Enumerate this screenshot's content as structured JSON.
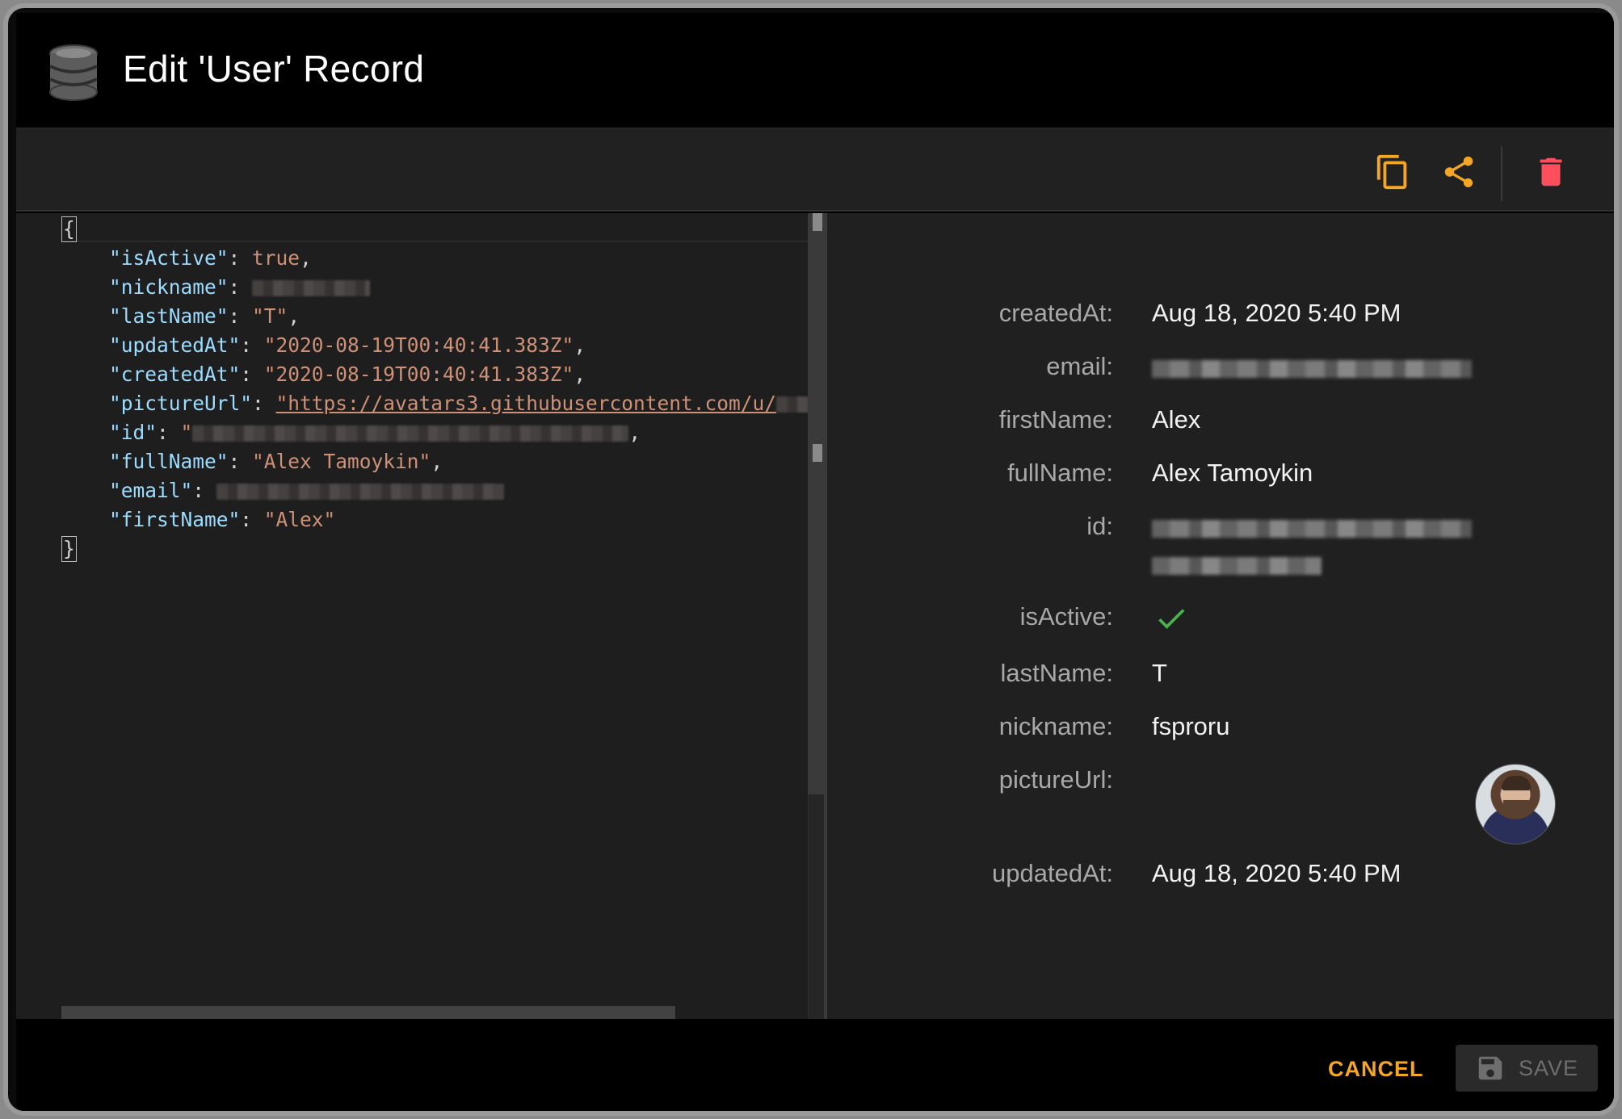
{
  "dialog": {
    "title": "Edit 'User' Record"
  },
  "toolbar": {
    "copy_icon": "copy-icon",
    "share_icon": "share-icon",
    "delete_icon": "trash-icon",
    "accent_color": "#f5a623",
    "danger_color": "#ff4f5e"
  },
  "editor": {
    "open_brace": "{",
    "close_brace": "}",
    "lines": [
      {
        "key": "\"isActive\"",
        "value": "true",
        "value_type": "literal",
        "trail": ","
      },
      {
        "key": "\"nickname\"",
        "value": "",
        "value_type": "redacted",
        "trail": ""
      },
      {
        "key": "\"lastName\"",
        "value": "\"T\"",
        "value_type": "string",
        "trail": ","
      },
      {
        "key": "\"updatedAt\"",
        "value": "\"2020-08-19T00:40:41.383Z\"",
        "value_type": "string",
        "trail": ","
      },
      {
        "key": "\"createdAt\"",
        "value": "\"2020-08-19T00:40:41.383Z\"",
        "value_type": "string",
        "trail": ","
      },
      {
        "key": "\"pictureUrl\"",
        "value": "\"https://avatars3.githubusercontent.com/u/",
        "value_type": "url",
        "trail": ""
      },
      {
        "key": "\"id\"",
        "value": "\"",
        "value_type": "redacted-string",
        "trail": ","
      },
      {
        "key": "\"fullName\"",
        "value": "\"Alex Tamoykin\"",
        "value_type": "string",
        "trail": ","
      },
      {
        "key": "\"email\"",
        "value": "",
        "value_type": "redacted",
        "trail": ""
      },
      {
        "key": "\"firstName\"",
        "value": "\"Alex\"",
        "value_type": "string",
        "trail": ""
      }
    ],
    "colors": {
      "key": "#9cdcfe",
      "string": "#ce9178",
      "punctuation": "#d4d4d4"
    }
  },
  "properties": {
    "rows": [
      {
        "label": "createdAt:",
        "value": "Aug 18, 2020 5:40 PM"
      },
      {
        "label": "email:",
        "value": ""
      },
      {
        "label": "firstName:",
        "value": "Alex"
      },
      {
        "label": "fullName:",
        "value": "Alex Tamoykin"
      },
      {
        "label": "id:",
        "value": ""
      },
      {
        "label": "isActive:",
        "value": ""
      },
      {
        "label": "lastName:",
        "value": "T"
      },
      {
        "label": "nickname:",
        "value": "fsproru"
      },
      {
        "label": "pictureUrl:",
        "value": ""
      },
      {
        "label": "updatedAt:",
        "value": "Aug 18, 2020 5:40 PM"
      }
    ],
    "isActive_icon": "checkmark-icon",
    "check_color": "#4caf50",
    "avatar": "avatar-image"
  },
  "footer": {
    "cancel_label": "CANCEL",
    "save_label": "SAVE",
    "save_icon": "floppy-disk-icon"
  }
}
